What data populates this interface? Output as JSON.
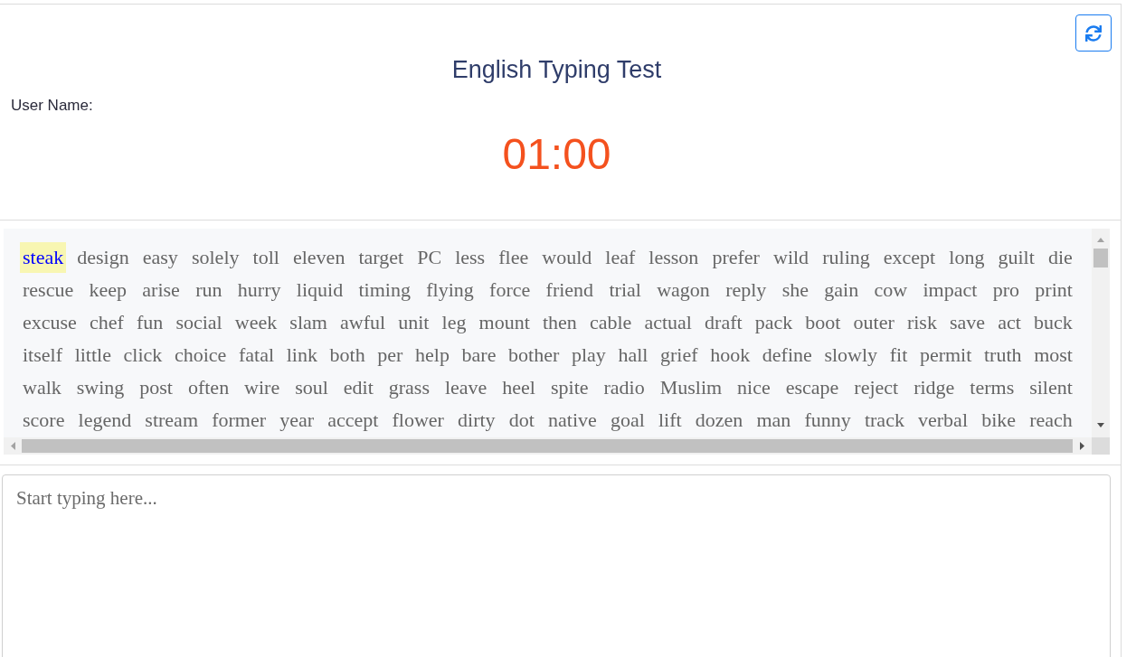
{
  "header": {
    "title": "English Typing Test",
    "user_name_label": "User Name:",
    "timer": "01:00"
  },
  "passage": {
    "lines": [
      {
        "words": [
          {
            "text": "steak",
            "current": true
          },
          {
            "text": "design",
            "current": false
          },
          {
            "text": "easy",
            "current": false
          },
          {
            "text": "solely",
            "current": false
          },
          {
            "text": "toll",
            "current": false
          },
          {
            "text": "eleven",
            "current": false
          },
          {
            "text": "target",
            "current": false
          },
          {
            "text": "PC",
            "current": false
          },
          {
            "text": "less",
            "current": false
          },
          {
            "text": "flee",
            "current": false
          },
          {
            "text": "would",
            "current": false
          },
          {
            "text": "leaf",
            "current": false
          },
          {
            "text": "lesson",
            "current": false
          },
          {
            "text": "prefer",
            "current": false
          },
          {
            "text": "wild",
            "current": false
          },
          {
            "text": "ruling",
            "current": false
          },
          {
            "text": "except",
            "current": false
          },
          {
            "text": "long",
            "current": false
          },
          {
            "text": "guilt",
            "current": false
          },
          {
            "text": "die",
            "current": false
          }
        ]
      },
      {
        "words": [
          {
            "text": "rescue",
            "current": false
          },
          {
            "text": "keep",
            "current": false
          },
          {
            "text": "arise",
            "current": false
          },
          {
            "text": "run",
            "current": false
          },
          {
            "text": "hurry",
            "current": false
          },
          {
            "text": "liquid",
            "current": false
          },
          {
            "text": "timing",
            "current": false
          },
          {
            "text": "flying",
            "current": false
          },
          {
            "text": "force",
            "current": false
          },
          {
            "text": "friend",
            "current": false
          },
          {
            "text": "trial",
            "current": false
          },
          {
            "text": "wagon",
            "current": false
          },
          {
            "text": "reply",
            "current": false
          },
          {
            "text": "she",
            "current": false
          },
          {
            "text": "gain",
            "current": false
          },
          {
            "text": "cow",
            "current": false
          },
          {
            "text": "impact",
            "current": false
          },
          {
            "text": "pro",
            "current": false
          },
          {
            "text": "print",
            "current": false
          }
        ]
      },
      {
        "words": [
          {
            "text": "excuse",
            "current": false
          },
          {
            "text": "chef",
            "current": false
          },
          {
            "text": "fun",
            "current": false
          },
          {
            "text": "social",
            "current": false
          },
          {
            "text": "week",
            "current": false
          },
          {
            "text": "slam",
            "current": false
          },
          {
            "text": "awful",
            "current": false
          },
          {
            "text": "unit",
            "current": false
          },
          {
            "text": "leg",
            "current": false
          },
          {
            "text": "mount",
            "current": false
          },
          {
            "text": "then",
            "current": false
          },
          {
            "text": "cable",
            "current": false
          },
          {
            "text": "actual",
            "current": false
          },
          {
            "text": "draft",
            "current": false
          },
          {
            "text": "pack",
            "current": false
          },
          {
            "text": "boot",
            "current": false
          },
          {
            "text": "outer",
            "current": false
          },
          {
            "text": "risk",
            "current": false
          },
          {
            "text": "save",
            "current": false
          },
          {
            "text": "act",
            "current": false
          },
          {
            "text": "buck",
            "current": false
          }
        ]
      },
      {
        "words": [
          {
            "text": "itself",
            "current": false
          },
          {
            "text": "little",
            "current": false
          },
          {
            "text": "click",
            "current": false
          },
          {
            "text": "choice",
            "current": false
          },
          {
            "text": "fatal",
            "current": false
          },
          {
            "text": "link",
            "current": false
          },
          {
            "text": "both",
            "current": false
          },
          {
            "text": "per",
            "current": false
          },
          {
            "text": "help",
            "current": false
          },
          {
            "text": "bare",
            "current": false
          },
          {
            "text": "bother",
            "current": false
          },
          {
            "text": "play",
            "current": false
          },
          {
            "text": "hall",
            "current": false
          },
          {
            "text": "grief",
            "current": false
          },
          {
            "text": "hook",
            "current": false
          },
          {
            "text": "define",
            "current": false
          },
          {
            "text": "slowly",
            "current": false
          },
          {
            "text": "fit",
            "current": false
          },
          {
            "text": "permit",
            "current": false
          },
          {
            "text": "truth",
            "current": false
          },
          {
            "text": "most",
            "current": false
          }
        ]
      },
      {
        "words": [
          {
            "text": "walk",
            "current": false
          },
          {
            "text": "swing",
            "current": false
          },
          {
            "text": "post",
            "current": false
          },
          {
            "text": "often",
            "current": false
          },
          {
            "text": "wire",
            "current": false
          },
          {
            "text": "soul",
            "current": false
          },
          {
            "text": "edit",
            "current": false
          },
          {
            "text": "grass",
            "current": false
          },
          {
            "text": "leave",
            "current": false
          },
          {
            "text": "heel",
            "current": false
          },
          {
            "text": "spite",
            "current": false
          },
          {
            "text": "radio",
            "current": false
          },
          {
            "text": "Muslim",
            "current": false
          },
          {
            "text": "nice",
            "current": false
          },
          {
            "text": "escape",
            "current": false
          },
          {
            "text": "reject",
            "current": false
          },
          {
            "text": "ridge",
            "current": false
          },
          {
            "text": "terms",
            "current": false
          },
          {
            "text": "silent",
            "current": false
          }
        ]
      },
      {
        "words": [
          {
            "text": "score",
            "current": false
          },
          {
            "text": "legend",
            "current": false
          },
          {
            "text": "stream",
            "current": false
          },
          {
            "text": "former",
            "current": false
          },
          {
            "text": "year",
            "current": false
          },
          {
            "text": "accept",
            "current": false
          },
          {
            "text": "flower",
            "current": false
          },
          {
            "text": "dirty",
            "current": false
          },
          {
            "text": "dot",
            "current": false
          },
          {
            "text": "native",
            "current": false
          },
          {
            "text": "goal",
            "current": false
          },
          {
            "text": "lift",
            "current": false
          },
          {
            "text": "dozen",
            "current": false
          },
          {
            "text": "man",
            "current": false
          },
          {
            "text": "funny",
            "current": false
          },
          {
            "text": "track",
            "current": false
          },
          {
            "text": "verbal",
            "current": false
          },
          {
            "text": "bike",
            "current": false
          },
          {
            "text": "reach",
            "current": false
          }
        ]
      }
    ]
  },
  "answer_box": {
    "placeholder": "Start typing here..."
  }
}
